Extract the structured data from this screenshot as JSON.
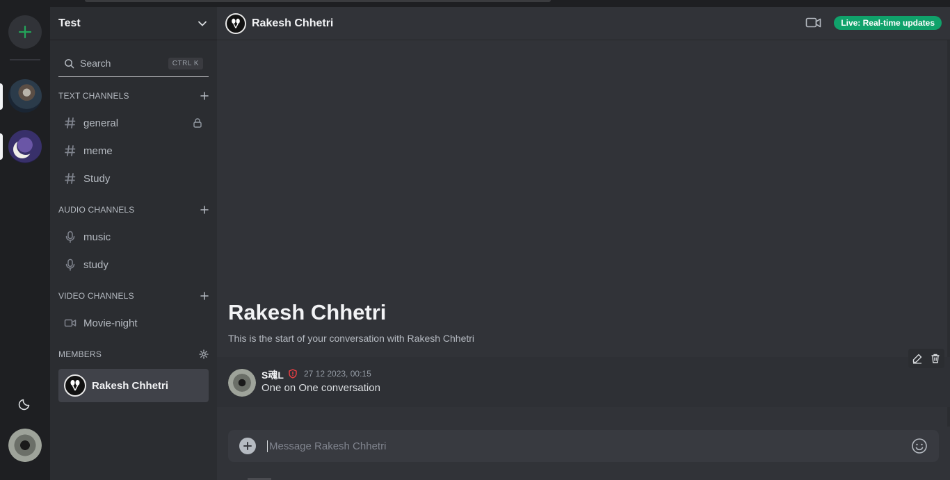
{
  "server": {
    "name": "Test"
  },
  "search": {
    "label": "Search",
    "shortcut": "CTRL K"
  },
  "sections": {
    "text": {
      "title": "TEXT CHANNELS",
      "channels": [
        {
          "name": "general",
          "locked": true
        },
        {
          "name": "meme"
        },
        {
          "name": "Study"
        }
      ]
    },
    "audio": {
      "title": "AUDIO CHANNELS",
      "channels": [
        {
          "name": "music"
        },
        {
          "name": "study"
        }
      ]
    },
    "video": {
      "title": "VIDEO CHANNELS",
      "channels": [
        {
          "name": "Movie-night"
        }
      ]
    },
    "members": {
      "title": "MEMBERS",
      "items": [
        {
          "name": "Rakesh Chhetri"
        }
      ]
    }
  },
  "chat": {
    "title": "Rakesh Chhetri",
    "live_badge": "Live: Real-time updates",
    "welcome_title": "Rakesh Chhetri",
    "welcome_subtitle": "This is the start of your conversation with Rakesh Chhetri",
    "messages": [
      {
        "author": "S魂L",
        "timestamp": "27 12 2023, 00:15",
        "text": "One on One conversation"
      }
    ],
    "composer_placeholder": "Message Rakesh Chhetri"
  },
  "colors": {
    "accent_green": "#23a55a",
    "live_badge": "#10a26b",
    "admin_badge": "#f23f43"
  }
}
